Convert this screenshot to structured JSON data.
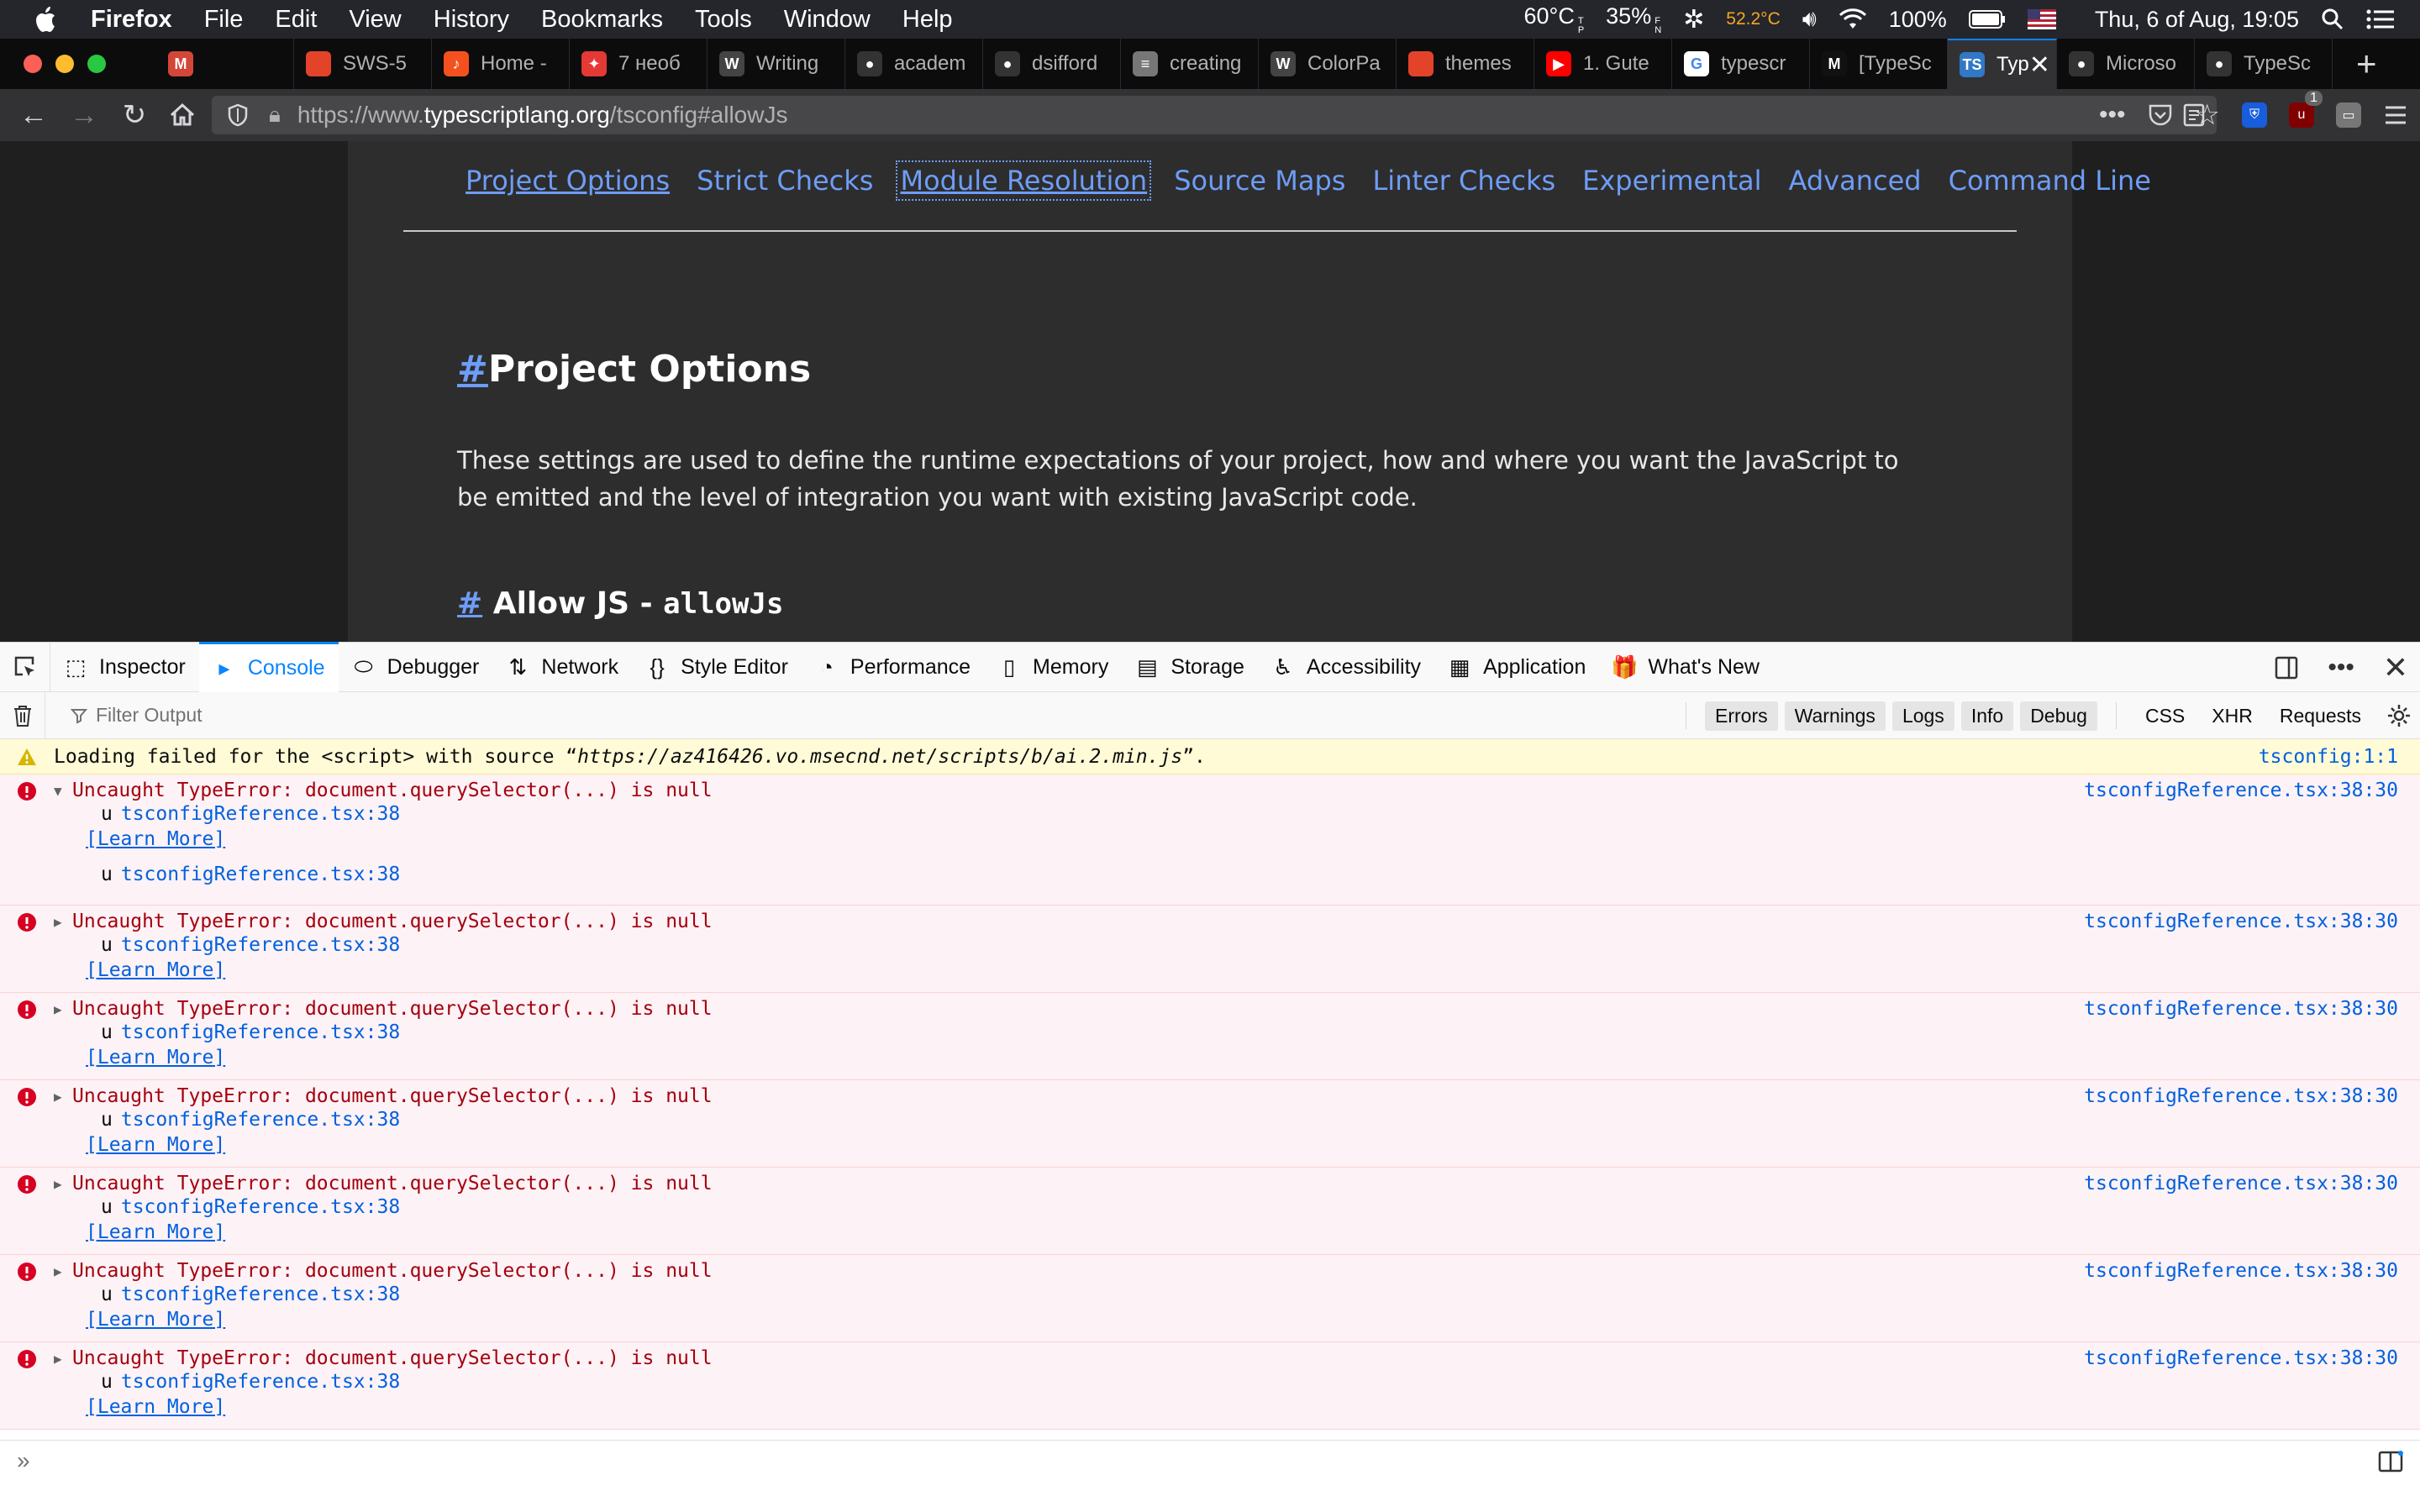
{
  "menubar": {
    "app_name": "Firefox",
    "items": [
      "File",
      "Edit",
      "View",
      "History",
      "Bookmarks",
      "Tools",
      "Window",
      "Help"
    ],
    "temp1": "60°C",
    "temp1_sub": [
      "T",
      "P"
    ],
    "fan": "35%",
    "fan_sub": [
      "F",
      "N"
    ],
    "temp2": "52.2°C",
    "battery": "100%",
    "datetime": "Thu, 6 of Aug, 19:05"
  },
  "tabs": [
    {
      "title": "",
      "icon": "gmail-icon",
      "color": "#d44638",
      "glyph": "M"
    },
    {
      "title": "SWS-5",
      "icon": "gitlab-icon",
      "color": "#e24329",
      "glyph": ""
    },
    {
      "title": "Home -",
      "icon": "music-icon",
      "color": "#f4511e",
      "glyph": "♪"
    },
    {
      "title": "7 необ",
      "icon": "shield-icon",
      "color": "#e53935",
      "glyph": "✦"
    },
    {
      "title": "Writing",
      "icon": "wordpress-icon",
      "color": "#444",
      "glyph": "W"
    },
    {
      "title": "academ",
      "icon": "github-icon",
      "color": "#333",
      "glyph": "●"
    },
    {
      "title": "dsifford",
      "icon": "github-icon",
      "color": "#333",
      "glyph": "●"
    },
    {
      "title": "creating",
      "icon": "document-icon",
      "color": "#777",
      "glyph": "≡"
    },
    {
      "title": "ColorPa",
      "icon": "wordpress-icon",
      "color": "#444",
      "glyph": "W"
    },
    {
      "title": "themes",
      "icon": "gitlab-icon",
      "color": "#e24329",
      "glyph": ""
    },
    {
      "title": "1. Gute",
      "icon": "youtube-icon",
      "color": "#ff0000",
      "glyph": "▶"
    },
    {
      "title": "typescr",
      "icon": "google-icon",
      "color": "#fff",
      "glyph": "G"
    },
    {
      "title": "[TypeSc",
      "icon": "medium-icon",
      "color": "#111",
      "glyph": "M"
    },
    {
      "title": "Typ",
      "icon": "typescript-icon",
      "color": "#3178c6",
      "glyph": "TS",
      "active": true
    },
    {
      "title": "Microso",
      "icon": "github-icon",
      "color": "#333",
      "glyph": "●"
    },
    {
      "title": "TypeSc",
      "icon": "github-icon",
      "color": "#333",
      "glyph": "●"
    }
  ],
  "urlbar": {
    "prefix": "https://www.",
    "domain": "typescriptlang.org",
    "path": "/tsconfig#allowJs"
  },
  "nav_badge": "1",
  "page": {
    "nav_links": [
      "Project Options",
      "Strict Checks",
      "Module Resolution",
      "Source Maps",
      "Linter Checks",
      "Experimental",
      "Advanced",
      "Command Line"
    ],
    "hash": "#",
    "section_title": "Project Options",
    "section_desc": "These settings are used to define the runtime expectations of your project, how and where you want the JavaScript to be emitted and the level of integration you want with existing JavaScript code.",
    "option_title": "Allow JS - ",
    "option_code": "allowJs"
  },
  "devtools": {
    "tabs": [
      {
        "label": "Inspector",
        "icon": "inspector-icon",
        "glyph": "⬚"
      },
      {
        "label": "Console",
        "icon": "console-icon",
        "glyph": "▸",
        "active": true
      },
      {
        "label": "Debugger",
        "icon": "debugger-icon",
        "glyph": "⬭"
      },
      {
        "label": "Network",
        "icon": "network-icon",
        "glyph": "⇅"
      },
      {
        "label": "Style Editor",
        "icon": "style-editor-icon",
        "glyph": "{}"
      },
      {
        "label": "Performance",
        "icon": "performance-icon",
        "glyph": "◔"
      },
      {
        "label": "Memory",
        "icon": "memory-icon",
        "glyph": "▯"
      },
      {
        "label": "Storage",
        "icon": "storage-icon",
        "glyph": "▤"
      },
      {
        "label": "Accessibility",
        "icon": "accessibility-icon",
        "glyph": "♿"
      },
      {
        "label": "Application",
        "icon": "application-icon",
        "glyph": "▦"
      },
      {
        "label": "What's New",
        "icon": "gift-icon",
        "glyph": "🎁"
      }
    ],
    "filter_placeholder": "Filter Output",
    "levels": [
      "Errors",
      "Warnings",
      "Logs",
      "Info",
      "Debug"
    ],
    "types": [
      "CSS",
      "XHR",
      "Requests"
    ]
  },
  "console": {
    "warning": {
      "text_prefix": "Loading failed for the <script> with source “",
      "url": "https://az416426.vo.msecnd.net/scripts/b/ai.2.min.js",
      "text_suffix": "”.",
      "source": "tsconfig:1:1"
    },
    "error_text": "Uncaught TypeError: document.querySelector(...) is null",
    "error_source": "tsconfigReference.tsx:38:30",
    "frame_fn": "u",
    "frame_loc": "tsconfigReference.tsx:38",
    "learn_more": "[Learn More]"
  }
}
